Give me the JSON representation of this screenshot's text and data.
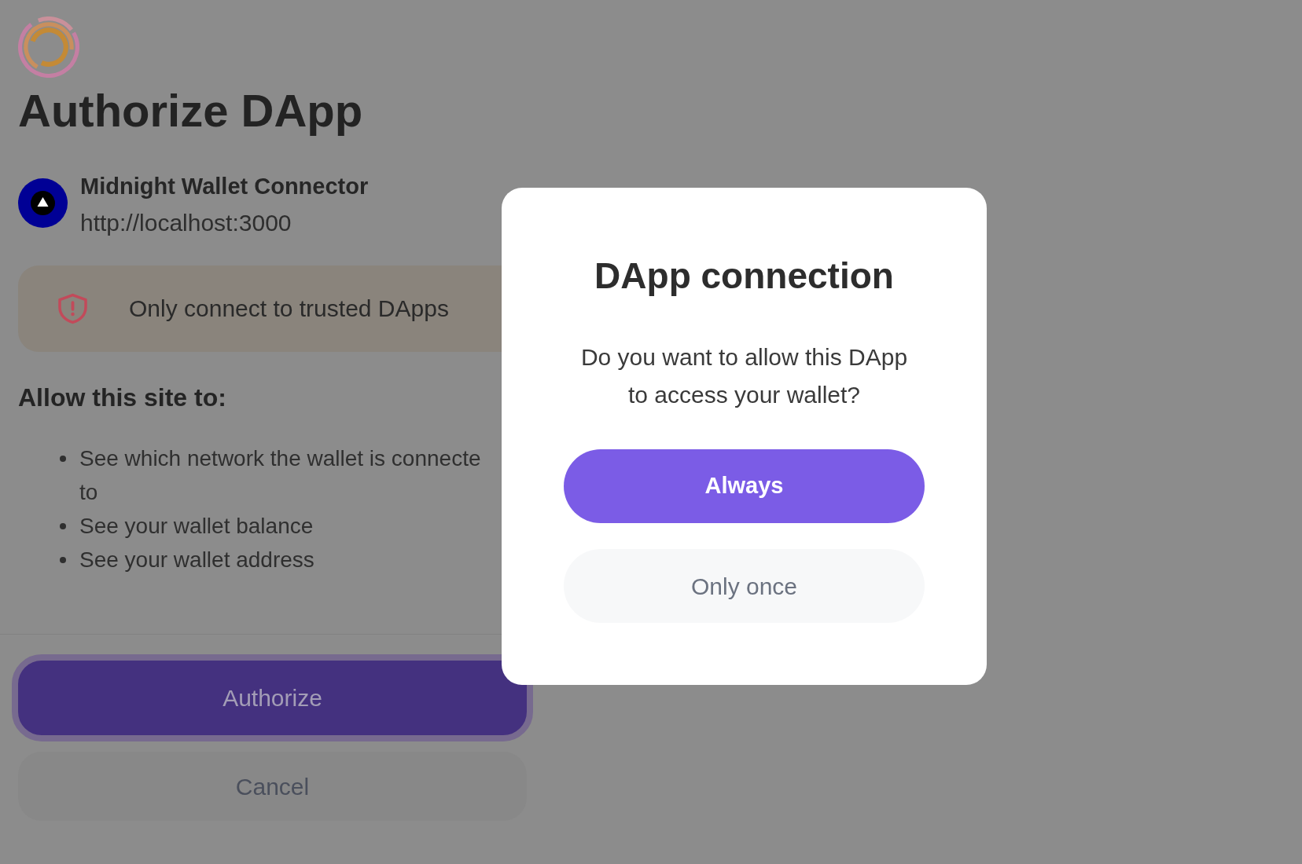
{
  "page": {
    "title": "Authorize DApp",
    "dapp_name": "Midnight Wallet Connector",
    "dapp_url": "http://localhost:3000"
  },
  "warning": {
    "text": "Only connect to trusted DApps"
  },
  "permissions": {
    "heading": "Allow this site to:",
    "items": [
      "See which network the wallet is connecte\nto",
      "See your wallet balance",
      "See your wallet address"
    ]
  },
  "actions": [
    {
      "label": "Authorize",
      "kind": "primary",
      "focused": true
    },
    {
      "label": "Cancel",
      "kind": "secondary",
      "focused": false
    }
  ],
  "dialog": {
    "title": "DApp connection",
    "message": "Do you want to allow this DApp to access your wallet?",
    "buttons": [
      {
        "label": "Always",
        "kind": "primary"
      },
      {
        "label": "Only once",
        "kind": "secondary"
      }
    ]
  }
}
